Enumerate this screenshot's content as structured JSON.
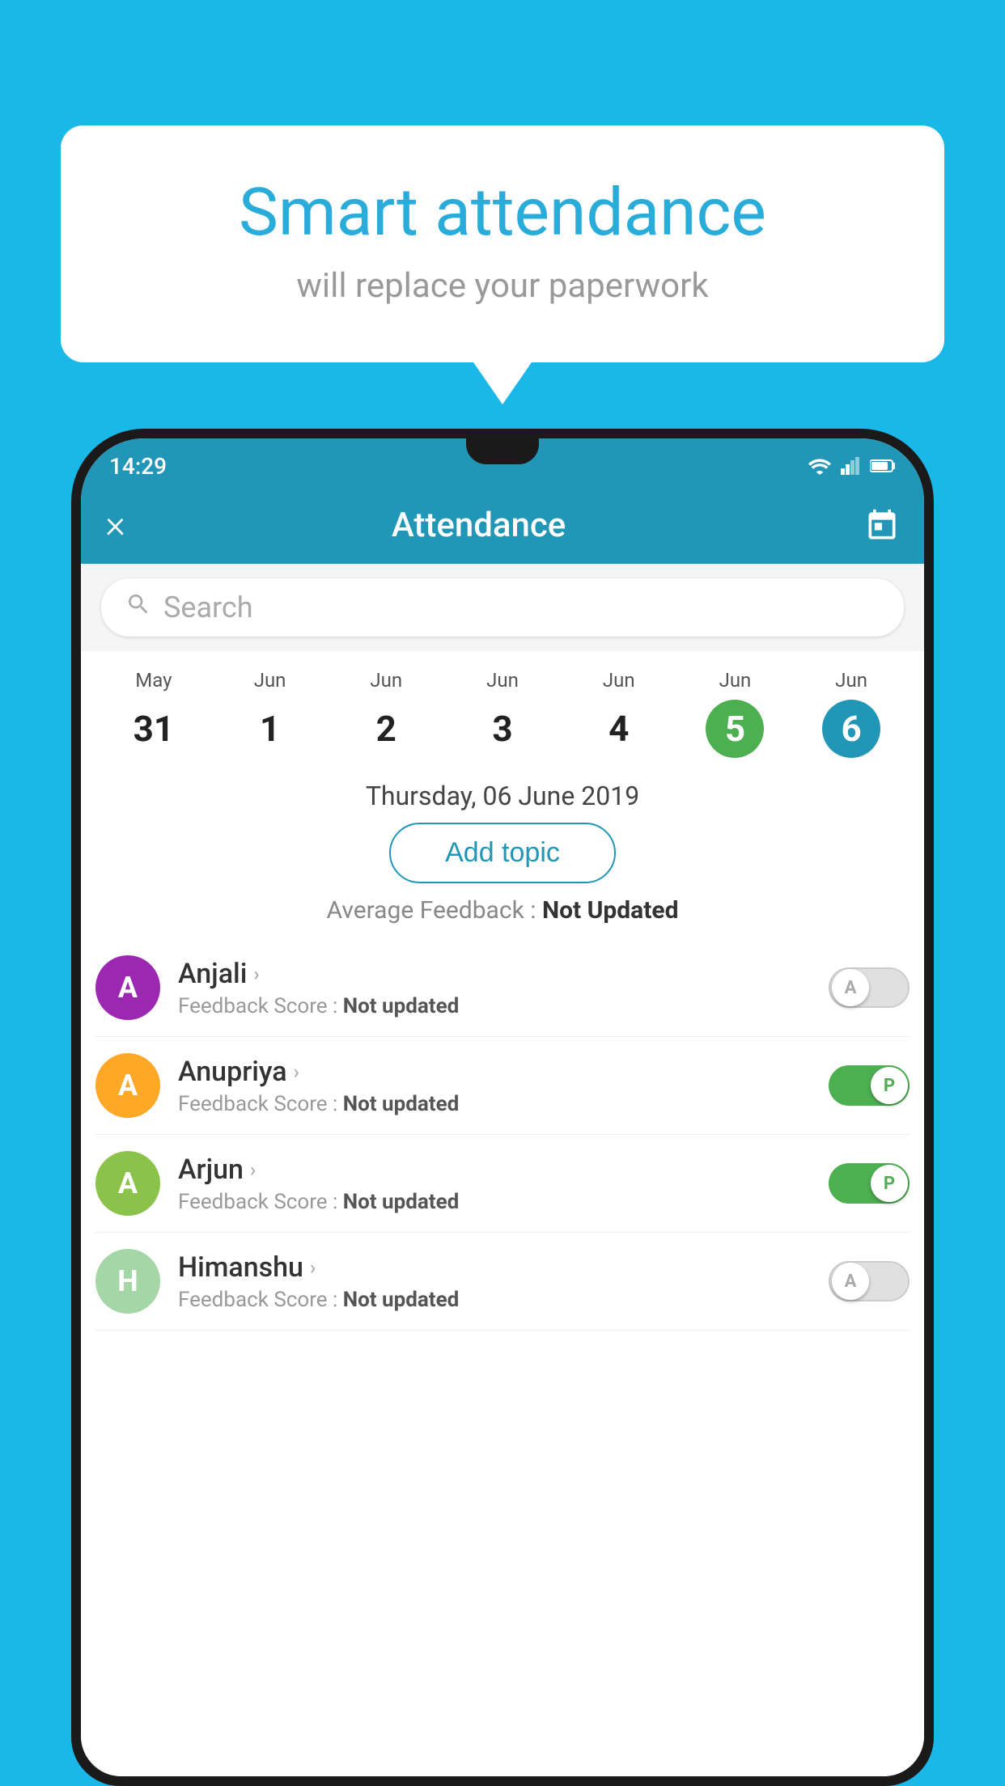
{
  "background_color": "#1ab8e8",
  "bubble": {
    "title": "Smart attendance",
    "subtitle": "will replace your paperwork"
  },
  "status_bar": {
    "time": "14:29"
  },
  "app_bar": {
    "title": "Attendance",
    "close_label": "×",
    "calendar_icon": "📅"
  },
  "search": {
    "placeholder": "Search"
  },
  "calendar": {
    "days": [
      {
        "month": "May",
        "date": "31",
        "state": "normal"
      },
      {
        "month": "Jun",
        "date": "1",
        "state": "normal"
      },
      {
        "month": "Jun",
        "date": "2",
        "state": "normal"
      },
      {
        "month": "Jun",
        "date": "3",
        "state": "normal"
      },
      {
        "month": "Jun",
        "date": "4",
        "state": "normal"
      },
      {
        "month": "Jun",
        "date": "5",
        "state": "today"
      },
      {
        "month": "Jun",
        "date": "6",
        "state": "selected"
      }
    ]
  },
  "selected_date": "Thursday, 06 June 2019",
  "add_topic_label": "Add topic",
  "average_feedback_label": "Average Feedback : ",
  "average_feedback_value": "Not Updated",
  "students": [
    {
      "name": "Anjali",
      "avatar_letter": "A",
      "avatar_color": "#9c27b0",
      "feedback_label": "Feedback Score : ",
      "feedback_value": "Not updated",
      "toggle_state": "off",
      "toggle_label": "A"
    },
    {
      "name": "Anupriya",
      "avatar_letter": "A",
      "avatar_color": "#ffa726",
      "feedback_label": "Feedback Score : ",
      "feedback_value": "Not updated",
      "toggle_state": "on",
      "toggle_label": "P"
    },
    {
      "name": "Arjun",
      "avatar_letter": "A",
      "avatar_color": "#8bc34a",
      "feedback_label": "Feedback Score : ",
      "feedback_value": "Not updated",
      "toggle_state": "on",
      "toggle_label": "P"
    },
    {
      "name": "Himanshu",
      "avatar_letter": "H",
      "avatar_color": "#a5d6a7",
      "feedback_label": "Feedback Score : ",
      "feedback_value": "Not updated",
      "toggle_state": "off",
      "toggle_label": "A"
    }
  ]
}
